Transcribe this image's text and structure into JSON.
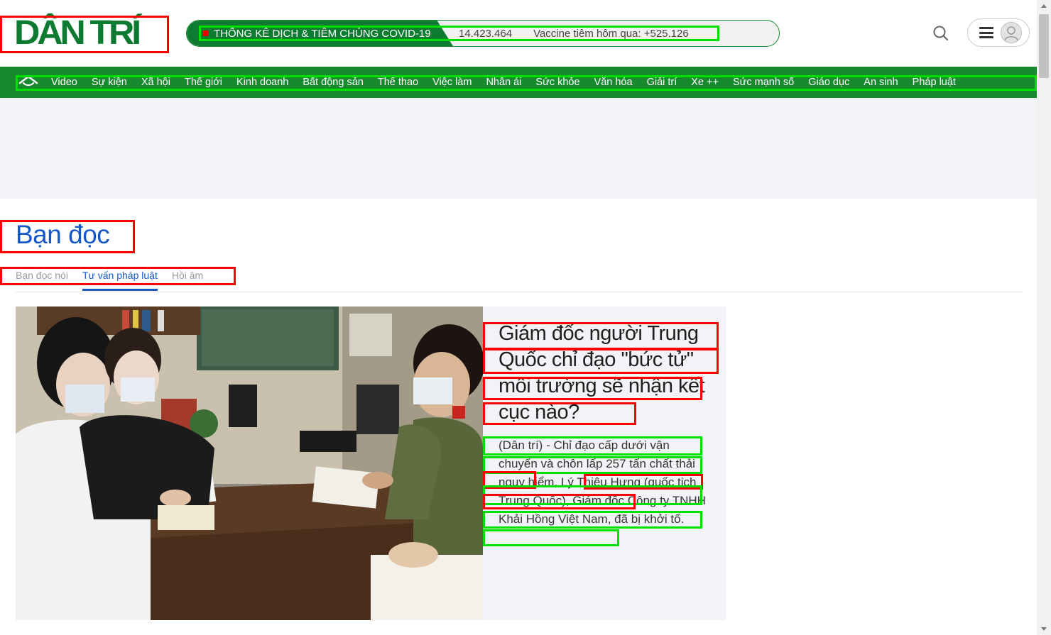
{
  "header": {
    "logo_text": "DÂN TRÍ",
    "covid": {
      "title": "THỐNG KÊ DỊCH & TIÊM CHỦNG COVID-19",
      "cases": "14.423.464",
      "vaccine": "Vaccine tiêm hôm qua: +525.126"
    }
  },
  "nav": {
    "items": [
      "Video",
      "Sự kiện",
      "Xã hội",
      "Thế giới",
      "Kinh doanh",
      "Bất động sản",
      "Thể thao",
      "Việc làm",
      "Nhân ái",
      "Sức khỏe",
      "Văn hóa",
      "Giải trí",
      "Xe ++",
      "Sức mạnh số",
      "Giáo dục",
      "An sinh",
      "Pháp luật"
    ]
  },
  "section": {
    "title": "Bạn đọc",
    "tabs": [
      {
        "label": "Bạn đọc nói",
        "active": false
      },
      {
        "label": "Tư vấn pháp luật",
        "active": true
      },
      {
        "label": "Hồi âm",
        "active": false
      }
    ]
  },
  "featured": {
    "title": "Giám đốc người Trung Quốc chỉ đạo \"bức tử\" môi trường sẽ nhận kết cục nào?",
    "sapo": "(Dân trí) - Chỉ đạo cấp dưới vận chuyển và chôn lấp 257 tấn chất thải nguy hiểm, Lý Thiệu Hưng (quốc tịch Trung Quốc), Giám đốc Công ty TNHH Khải Hồng Việt Nam, đã bị khởi tố."
  },
  "colors": {
    "brand_green": "#168a2d",
    "logo_green": "#0d7a32",
    "section_blue": "#1458c8",
    "annotation_red": "#ff0000",
    "annotation_green": "#00e000"
  },
  "icons": [
    "search-icon",
    "menu-icon",
    "user-icon",
    "home-icon"
  ]
}
